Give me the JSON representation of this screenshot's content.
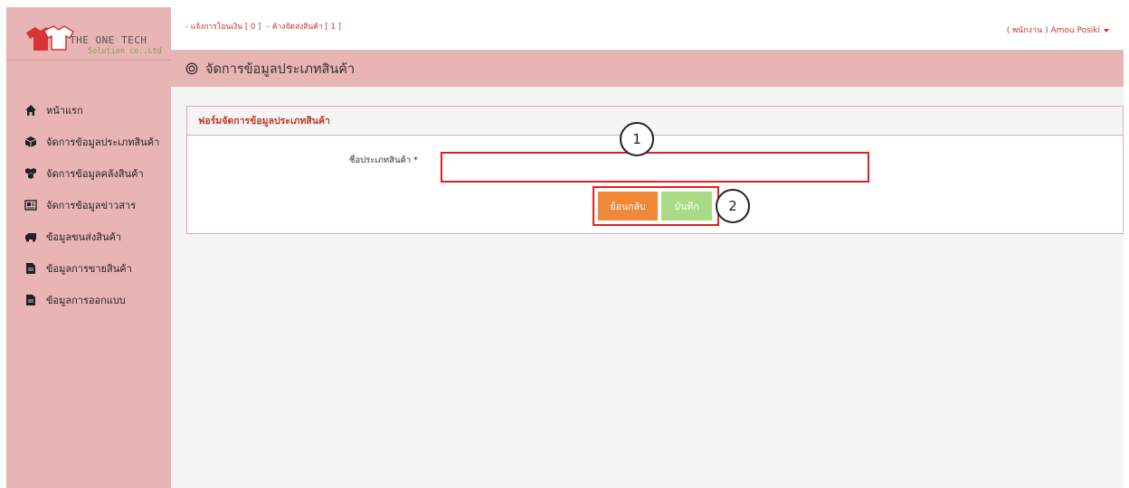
{
  "logo": {
    "title": "THE ONE TECH",
    "subtitle": "Solution co.,Ltd"
  },
  "sidebar": {
    "items": [
      {
        "label": "หน้าแรก",
        "icon": "home-icon"
      },
      {
        "label": "จัดการข้อมูลประเภทสินค้า",
        "icon": "cube-icon"
      },
      {
        "label": "จัดการข้อมูลคลังสินค้า",
        "icon": "cubes-icon"
      },
      {
        "label": "จัดการข้อมูลข่าวสาร",
        "icon": "newspaper-icon"
      },
      {
        "label": "ข้อมูลขนส่งสินค้า",
        "icon": "truck-icon"
      },
      {
        "label": "ข้อมูลการขายสินค้า",
        "icon": "file-icon"
      },
      {
        "label": "ข้อมูลการออกแบบ",
        "icon": "file-icon"
      }
    ]
  },
  "topbar": {
    "notice_transfer": "- แจ้งการโอนเงิน [ 0 ]",
    "notice_shipping": "- ค้างจัดส่งสินค้า [ 1 ]",
    "user": "( พนักงาน ) Amou Posiki"
  },
  "page": {
    "title": "จัดการข้อมูลประเภทสินค้า"
  },
  "form": {
    "panel_title": "ฟอร์มจัดการข้อมูลประเภทสินค้า",
    "field_label": "ชื่อประเภทสินค้า *",
    "field_value": "",
    "back_label": "ย้อนกลับ",
    "save_label": "บันทึก"
  },
  "callouts": {
    "one": "1",
    "two": "2"
  },
  "colors": {
    "sidebar_bg": "#e8b4b4",
    "accent_red": "#c0392b",
    "back_button": "#f0883a",
    "save_button": "#a8db84",
    "highlight": "#e02020"
  }
}
